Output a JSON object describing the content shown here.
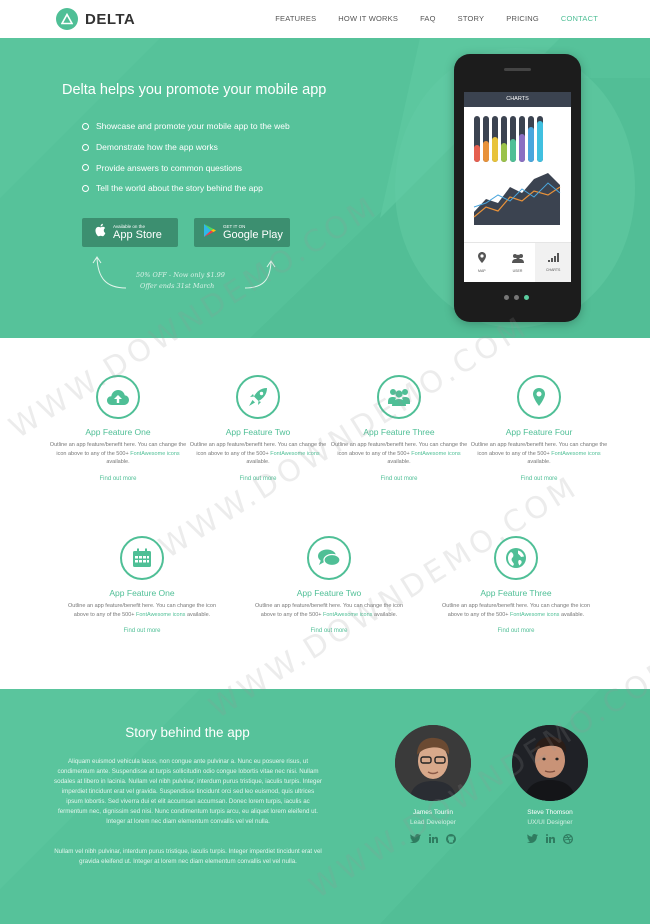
{
  "header": {
    "brand": "DELTA",
    "nav": [
      "FEATURES",
      "HOW IT WORKS",
      "FAQ",
      "STORY",
      "PRICING",
      "CONTACT"
    ],
    "active_index": 5
  },
  "hero": {
    "title": "Delta helps you promote your mobile app",
    "bullets": [
      "Showcase and promote your mobile app to the web",
      "Demonstrate how the app works",
      "Provide answers to common questions",
      "Tell the world about the story behind the app"
    ],
    "appstore": {
      "small": "Available on the",
      "big": "App Store"
    },
    "googleplay": {
      "small": "GET IT ON",
      "big": "Google Play"
    },
    "note_line1": "50% OFF - Now only $1.99",
    "note_line2": "Offer ends 31st March",
    "phone": {
      "screen_title": "CHARTS",
      "tabs": [
        "MAP",
        "USER",
        "CHARTS"
      ],
      "active_tab": 2
    }
  },
  "features_row1": [
    {
      "title": "App Feature One",
      "icon": "cloud-upload-icon"
    },
    {
      "title": "App Feature Two",
      "icon": "rocket-icon"
    },
    {
      "title": "App Feature Three",
      "icon": "users-icon"
    },
    {
      "title": "App Feature Four",
      "icon": "map-marker-icon"
    }
  ],
  "features_row2": [
    {
      "title": "App Feature One",
      "icon": "calendar-icon"
    },
    {
      "title": "App Feature Two",
      "icon": "comments-icon"
    },
    {
      "title": "App Feature Three",
      "icon": "globe-icon"
    }
  ],
  "feature_desc_1": "Outline an app feature/benefit here. You can change the icon above to any of the 500+",
  "feature_desc_fa": "FontAwesome icons",
  "feature_desc_2": "available.",
  "feature_link": "Find out more",
  "story": {
    "title": "Story behind the app",
    "para1": "Aliquam euismod vehicula lacus, non congue ante pulvinar a. Nunc eu posuere risus, ut condimentum ante. Suspendisse at turpis sollicitudin odio congue lobortis vitae nec nisi. Nullam sodales at libero in lacinia. Nullam vel nibh pulvinar, interdum purus tristique, iaculis turpis. Integer imperdiet tincidunt erat vel gravida. Suspendisse tincidunt orci sed leo euismod, quis ultrices ipsum lobortis. Sed viverra dui et elit accumsan accumsan. Donec lorem turpis, iaculis ac fermentum nec, dignissim sed nisi. Nunc condimentum turpis arcu, eu aliquet lorem eleifend ut. Integer at lorem nec diam elementum convallis vel vel nulla.",
    "para2": "Nullam vel nibh pulvinar, interdum purus tristique, iaculis turpis. Integer imperdiet tincidunt erat vel gravida eleifend ut. Integer at lorem nec diam elementum convallis vel vel nulla.",
    "people": [
      {
        "name": "James Tourlin",
        "role": "Lead Developer"
      },
      {
        "name": "Steve Thomson",
        "role": "UX/UI Designer"
      }
    ]
  },
  "watermark": "WWW.DOWNDEMO.COM",
  "colors": {
    "accent": "#4fbf96",
    "hero": "#56c29a",
    "dark_button": "#3c8f70"
  }
}
